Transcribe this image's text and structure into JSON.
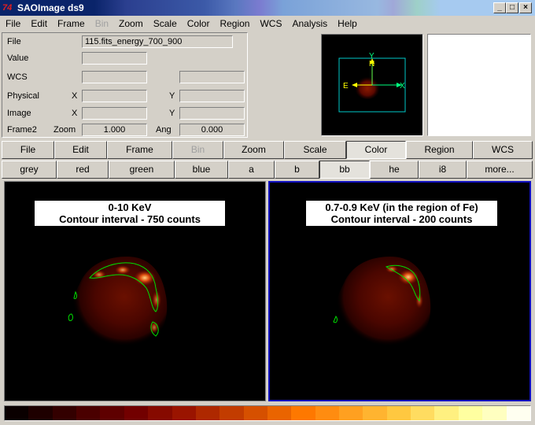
{
  "window": {
    "title": "SAOImage ds9",
    "app_icon_text": "74"
  },
  "menubar": {
    "items": [
      "File",
      "Edit",
      "Frame",
      "Bin",
      "Zoom",
      "Scale",
      "Color",
      "Region",
      "WCS",
      "Analysis",
      "Help"
    ],
    "disabled": [
      "Bin"
    ]
  },
  "info": {
    "file_label": "File",
    "file_value": "115.fits_energy_700_900",
    "value_label": "Value",
    "wcs_label": "WCS",
    "physical_label": "Physical",
    "image_label": "Image",
    "x_label": "X",
    "y_label": "Y",
    "frame_label": "Frame2",
    "zoom_label": "Zoom",
    "zoom_value": "1.000",
    "angle_label": "Ang",
    "angle_value": "0.000"
  },
  "panner": {
    "north_label": "N",
    "east_label": "E",
    "x_label": "X",
    "y_label": "Y"
  },
  "buttonbar": {
    "main": [
      "File",
      "Edit",
      "Frame",
      "Bin",
      "Zoom",
      "Scale",
      "Color",
      "Region",
      "WCS"
    ],
    "main_disabled": "Bin",
    "main_active": "Color",
    "colors": [
      "grey",
      "red",
      "green",
      "blue",
      "a",
      "b",
      "bb",
      "he",
      "i8",
      "more..."
    ],
    "colors_active": "bb"
  },
  "frames": {
    "left": {
      "line1": "0-10 KeV",
      "line2": "Contour interval - 750 counts"
    },
    "right": {
      "line1": "0.7-0.9 KeV (in the region of Fe)",
      "line2": "Contour interval - 200 counts"
    }
  },
  "colorbar": {
    "colors": [
      "#0a0000",
      "#1e0000",
      "#330000",
      "#4a0000",
      "#5e0000",
      "#720000",
      "#860a00",
      "#9a1400",
      "#ae2800",
      "#c23c00",
      "#d65000",
      "#ea6400",
      "#fe7800",
      "#ff8c10",
      "#ffa020",
      "#ffb430",
      "#ffc840",
      "#ffdc60",
      "#fff080",
      "#ffffa0",
      "#ffffc0",
      "#fffff0"
    ]
  },
  "theme": {
    "title_bar": "#0a246a",
    "frame_active_border": "#1010c0",
    "contour_green": "#00e000",
    "panner_box": "#00c8c8",
    "panner_arrow": "#ffff00"
  }
}
